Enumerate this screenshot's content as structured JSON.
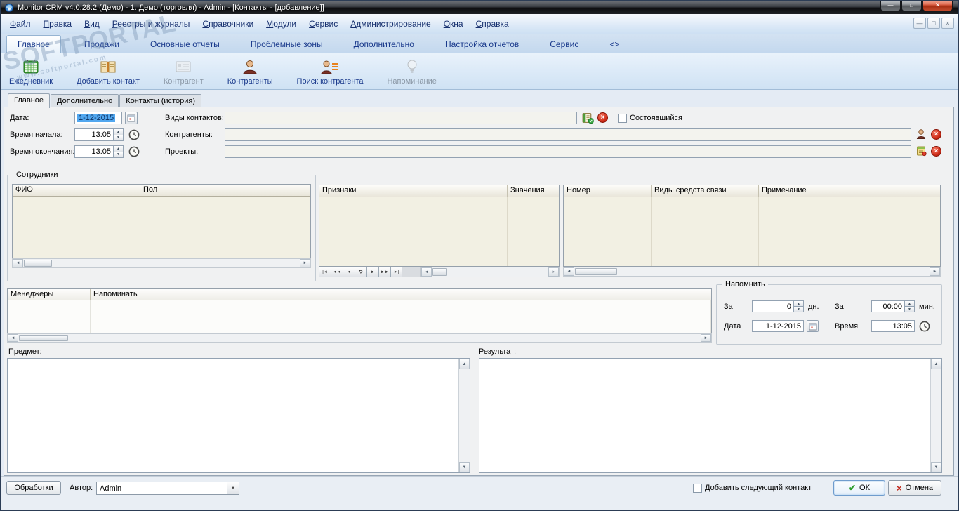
{
  "icons": {
    "minimize": "—",
    "maximize": "□",
    "close": "×",
    "mdi_minimize": "—",
    "mdi_restore": "□",
    "mdi_close": "×",
    "scroll_left": "◄",
    "scroll_right": "►",
    "scroll_up": "▲",
    "scroll_down": "▼",
    "spin_up": "▲",
    "spin_down": "▼",
    "dropdown": "▼",
    "ok_check": "✔",
    "cancel_x": "×"
  },
  "watermark": {
    "text": "SOFTPORTAL",
    "subtext": "www.softportal.com"
  },
  "titlebar": {
    "title": "Monitor CRM v4.0.28.2 (Демо) - 1. Демо (торговля) - Admin - [Контакты - [добавление]]"
  },
  "menubar": {
    "items": [
      "Файл",
      "Правка",
      "Вид",
      "Реестры и журналы",
      "Справочники",
      "Модули",
      "Сервис",
      "Администрирование",
      "Окна",
      "Справка"
    ]
  },
  "ribbon_tabs": {
    "items": [
      "Главное",
      "Продажи",
      "Основные отчеты",
      "Проблемные зоны",
      "Дополнительно",
      "Настройка отчетов",
      "Сервис",
      "<>"
    ],
    "active": "Главное"
  },
  "toolbar": {
    "buttons": [
      {
        "label": "Ежедневник"
      },
      {
        "label": "Добавить контакт"
      },
      {
        "label": "Контрагент"
      },
      {
        "label": "Контрагенты"
      },
      {
        "label": "Поиск контрагента"
      },
      {
        "label": "Напоминание"
      }
    ]
  },
  "form_tabs": {
    "items": [
      "Главное",
      "Дополнительно",
      "Контакты (история)"
    ],
    "active": "Главное"
  },
  "fields": {
    "date": {
      "label": "Дата:",
      "value": "1-12-2015"
    },
    "start_time": {
      "label": "Время начала:",
      "value": "13:05"
    },
    "end_time": {
      "label": "Время окончания:",
      "value": "13:05"
    },
    "contact_types": {
      "label": "Виды контактов:",
      "value": ""
    },
    "happened": {
      "label": "Состоявшийся",
      "checked": false
    },
    "contractors": {
      "label": "Контрагенты:",
      "value": ""
    },
    "projects": {
      "label": "Проекты:",
      "value": ""
    }
  },
  "employees": {
    "group_title": "Сотрудники",
    "columns": [
      "ФИО",
      "Пол"
    ]
  },
  "attributes": {
    "columns": [
      "Признаки",
      "Значения"
    ],
    "nav_buttons": [
      "|◄",
      "◄◄",
      "◄",
      "?",
      "►",
      "►►",
      "►|"
    ]
  },
  "communications": {
    "columns": [
      "Номер",
      "Виды средств связи",
      "Примечание"
    ]
  },
  "managers": {
    "columns": [
      "Менеджеры",
      "Напоминать"
    ]
  },
  "remind": {
    "group_title": "Напомнить",
    "days": {
      "label": "За",
      "value": "0",
      "unit": "дн."
    },
    "minutes": {
      "label": "За",
      "value": "00:00",
      "unit": "мин."
    },
    "date": {
      "label": "Дата",
      "value": "1-12-2015"
    },
    "time": {
      "label": "Время",
      "value": "13:05"
    }
  },
  "subject": {
    "label": "Предмет:",
    "value": ""
  },
  "result": {
    "label": "Результат:",
    "value": ""
  },
  "footer": {
    "process_button": "Обработки",
    "author_label": "Автор:",
    "author_value": "Admin",
    "next_contact_checkbox": "Добавить следующий контакт",
    "ok_button": "ОК",
    "cancel_button": "Отмена"
  }
}
